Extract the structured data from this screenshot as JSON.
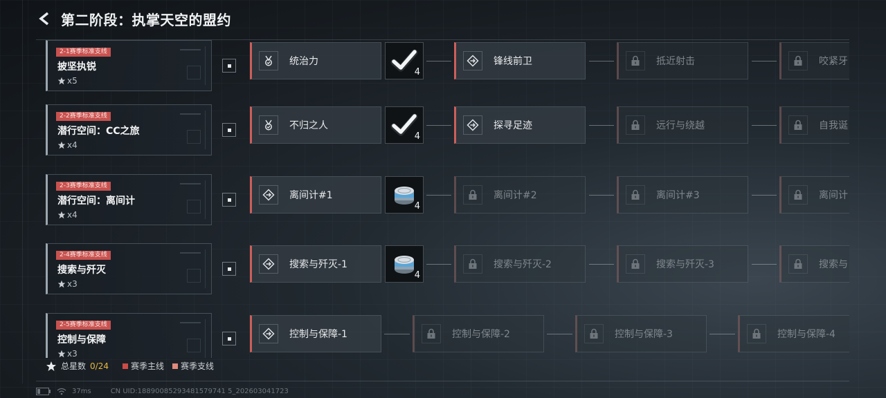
{
  "header": {
    "back_icon": "back-arrow-icon",
    "title": "第二阶段：执掌天空的盟约"
  },
  "colors": {
    "accent_red": "#cc5f5b",
    "tag_red": "#c8524f",
    "star_total": "#e8b840",
    "locked_text": "#7f878d"
  },
  "missions": [
    {
      "tag": "2-1赛季标准支线",
      "name": "披坚执锐",
      "stars": "x5",
      "nodes": [
        {
          "label": "统治力",
          "icon": "medal-icon",
          "state": "active"
        },
        {
          "label": "锋线前卫",
          "icon": "diamond-arrow-icon",
          "state": "active"
        },
        {
          "label": "抵近射击",
          "icon": "lock-icon",
          "state": "locked"
        },
        {
          "label": "咬紧牙",
          "icon": "lock-icon",
          "state": "locked"
        }
      ],
      "reward": {
        "icon": "checkmark-icon",
        "qty": "4"
      }
    },
    {
      "tag": "2-2赛季标准支线",
      "name": "潜行空间：CC之旅",
      "stars": "x4",
      "nodes": [
        {
          "label": "不归之人",
          "icon": "medal-icon",
          "state": "active"
        },
        {
          "label": "探寻足迹",
          "icon": "diamond-arrow-icon",
          "state": "active"
        },
        {
          "label": "远行与绕越",
          "icon": "lock-icon",
          "state": "locked"
        },
        {
          "label": "自我诞",
          "icon": "lock-icon",
          "state": "locked"
        }
      ],
      "reward": {
        "icon": "checkmark-icon",
        "qty": "4"
      }
    },
    {
      "tag": "2-3赛季标准支线",
      "name": "潜行空间：离间计",
      "stars": "x4",
      "nodes": [
        {
          "label": "离间计#1",
          "icon": "diamond-arrow-icon",
          "state": "active"
        },
        {
          "label": "离间计#2",
          "icon": "lock-icon",
          "state": "locked"
        },
        {
          "label": "离间计#3",
          "icon": "lock-icon",
          "state": "locked"
        },
        {
          "label": "离间计",
          "icon": "lock-icon",
          "state": "locked"
        }
      ],
      "reward": {
        "icon": "tin-can-icon",
        "qty": "4"
      }
    },
    {
      "tag": "2-4赛季标准支线",
      "name": "搜索与歼灭",
      "stars": "x3",
      "nodes": [
        {
          "label": "搜索与歼灭-1",
          "icon": "diamond-arrow-icon",
          "state": "active"
        },
        {
          "label": "搜索与歼灭-2",
          "icon": "lock-icon",
          "state": "locked"
        },
        {
          "label": "搜索与歼灭-3",
          "icon": "lock-icon",
          "state": "locked"
        },
        {
          "label": "搜索与",
          "icon": "lock-icon",
          "state": "locked"
        }
      ],
      "reward": {
        "icon": "tin-can-icon",
        "qty": "4"
      }
    },
    {
      "tag": "2-5赛季标准支线",
      "name": "控制与保障",
      "stars": "x3",
      "nodes": [
        {
          "label": "控制与保障-1",
          "icon": "diamond-arrow-icon",
          "state": "active"
        },
        {
          "label": "控制与保障-2",
          "icon": "lock-icon",
          "state": "locked"
        },
        {
          "label": "控制与保障-3",
          "icon": "lock-icon",
          "state": "locked"
        },
        {
          "label": "控制与保障-4",
          "icon": "lock-icon",
          "state": "locked"
        }
      ],
      "reward": null
    }
  ],
  "legend": {
    "total_label": "总星数",
    "total_value": "0/24",
    "main_label": "赛季主线",
    "side_label": "赛季支线"
  },
  "status": {
    "ping": "37ms",
    "uid": "CN UID:18890085293481579741 5_202603041723"
  }
}
